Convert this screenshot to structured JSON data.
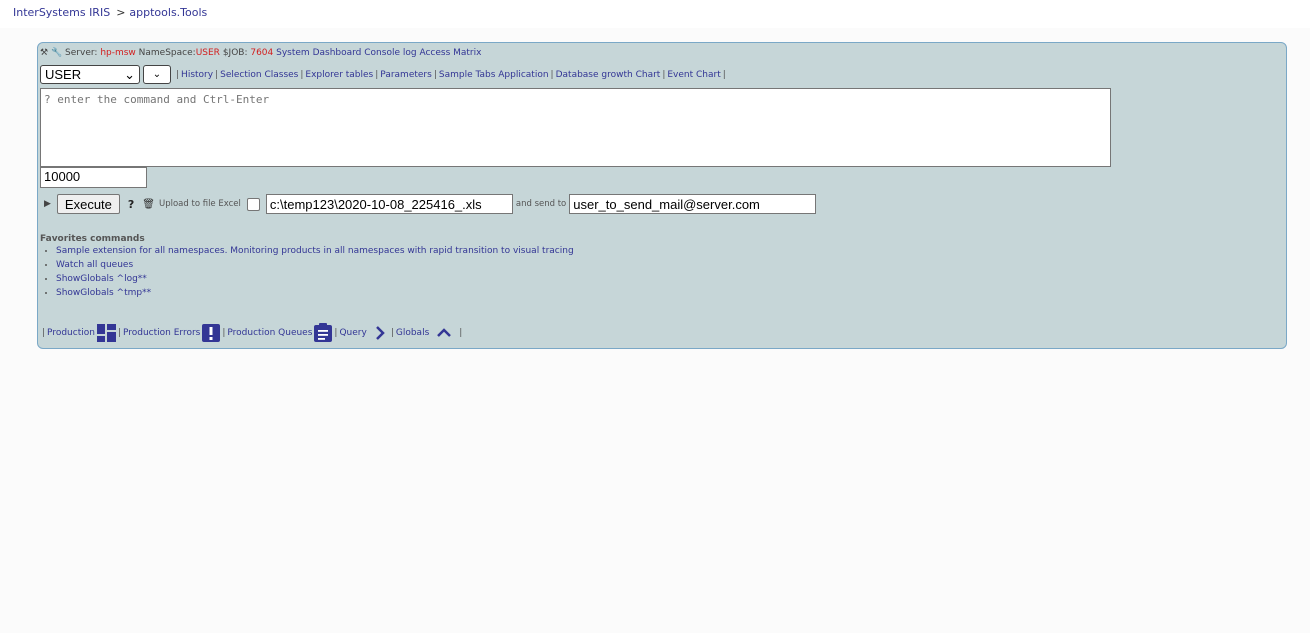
{
  "breadcrumb": {
    "root": "InterSystems IRIS",
    "separator": ">",
    "current": "apptools.Tools"
  },
  "status": {
    "server_label": "Server:",
    "server_value": "hp-msw",
    "namespace_label": "NameSpace:",
    "namespace_value": "USER",
    "job_label": "$JOB:",
    "job_value": "7604",
    "links": [
      "System Dashboard",
      "Console log",
      "Access Matrix"
    ]
  },
  "namespace_select": {
    "value": "USER"
  },
  "nav_links": [
    "History",
    "Selection Classes",
    "Explorer tables",
    "Parameters",
    "Sample Tabs Application",
    "Database growth Chart",
    "Event Chart"
  ],
  "command": {
    "placeholder": "? enter the command and Ctrl-Enter"
  },
  "max_rows": {
    "value": "10000"
  },
  "execute": {
    "button": "Execute",
    "help": "?",
    "upload_label": "Upload to file Excel",
    "file_value": "c:\\temp123\\2020-10-08_225416_.xls",
    "send_label": "and send to",
    "email_value": "user_to_send_mail@server.com"
  },
  "favorites": {
    "title": "Favorites commands",
    "items": [
      "Sample extension for all namespaces. Monitoring products in all namespaces with rapid transition to visual tracing",
      "Watch all queues",
      "ShowGlobals ^log**",
      "ShowGlobals ^tmp**"
    ]
  },
  "bottom_links": [
    "Production",
    "Production Errors",
    "Production Queues",
    "Query",
    "Globals"
  ],
  "colors": {
    "accent": "#333695",
    "status_red": "#d21f1f",
    "panel_bg": "#c6d6d8"
  }
}
